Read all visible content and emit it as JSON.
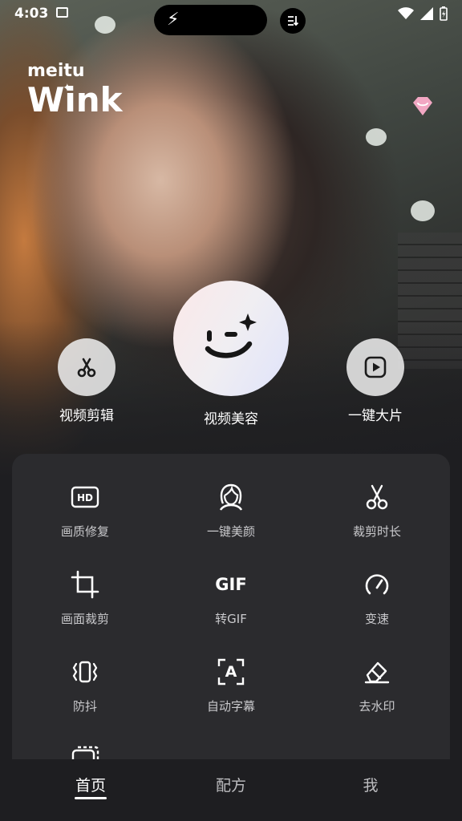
{
  "status_bar": {
    "time": "4:03"
  },
  "brand": {
    "maker": "meitu",
    "app": "Wink"
  },
  "hero_actions": [
    {
      "label": "视频剪辑",
      "icon": "scissors-icon"
    },
    {
      "label": "视频美容",
      "icon": "wink-face-icon"
    },
    {
      "label": "一键大片",
      "icon": "play-square-icon"
    }
  ],
  "tools": [
    {
      "label": "画质修复",
      "icon": "hd-icon"
    },
    {
      "label": "一键美颜",
      "icon": "face-beauty-icon"
    },
    {
      "label": "裁剪时长",
      "icon": "scissors-icon"
    },
    {
      "label": "画面裁剪",
      "icon": "crop-icon"
    },
    {
      "label": "转GIF",
      "icon": "gif-icon",
      "icon_text": "GIF"
    },
    {
      "label": "变速",
      "icon": "speedometer-icon"
    },
    {
      "label": "防抖",
      "icon": "stabilize-icon"
    },
    {
      "label": "自动字幕",
      "icon": "auto-subtitle-icon",
      "icon_text": "A"
    },
    {
      "label": "去水印",
      "icon": "eraser-icon"
    }
  ],
  "bottom_nav": [
    {
      "label": "首页",
      "active": true
    },
    {
      "label": "配方",
      "active": false
    },
    {
      "label": "我",
      "active": false
    }
  ],
  "colors": {
    "background": "#1e1e21",
    "panel": "#2b2b2e",
    "vip_pink": "#f2a7c3"
  }
}
